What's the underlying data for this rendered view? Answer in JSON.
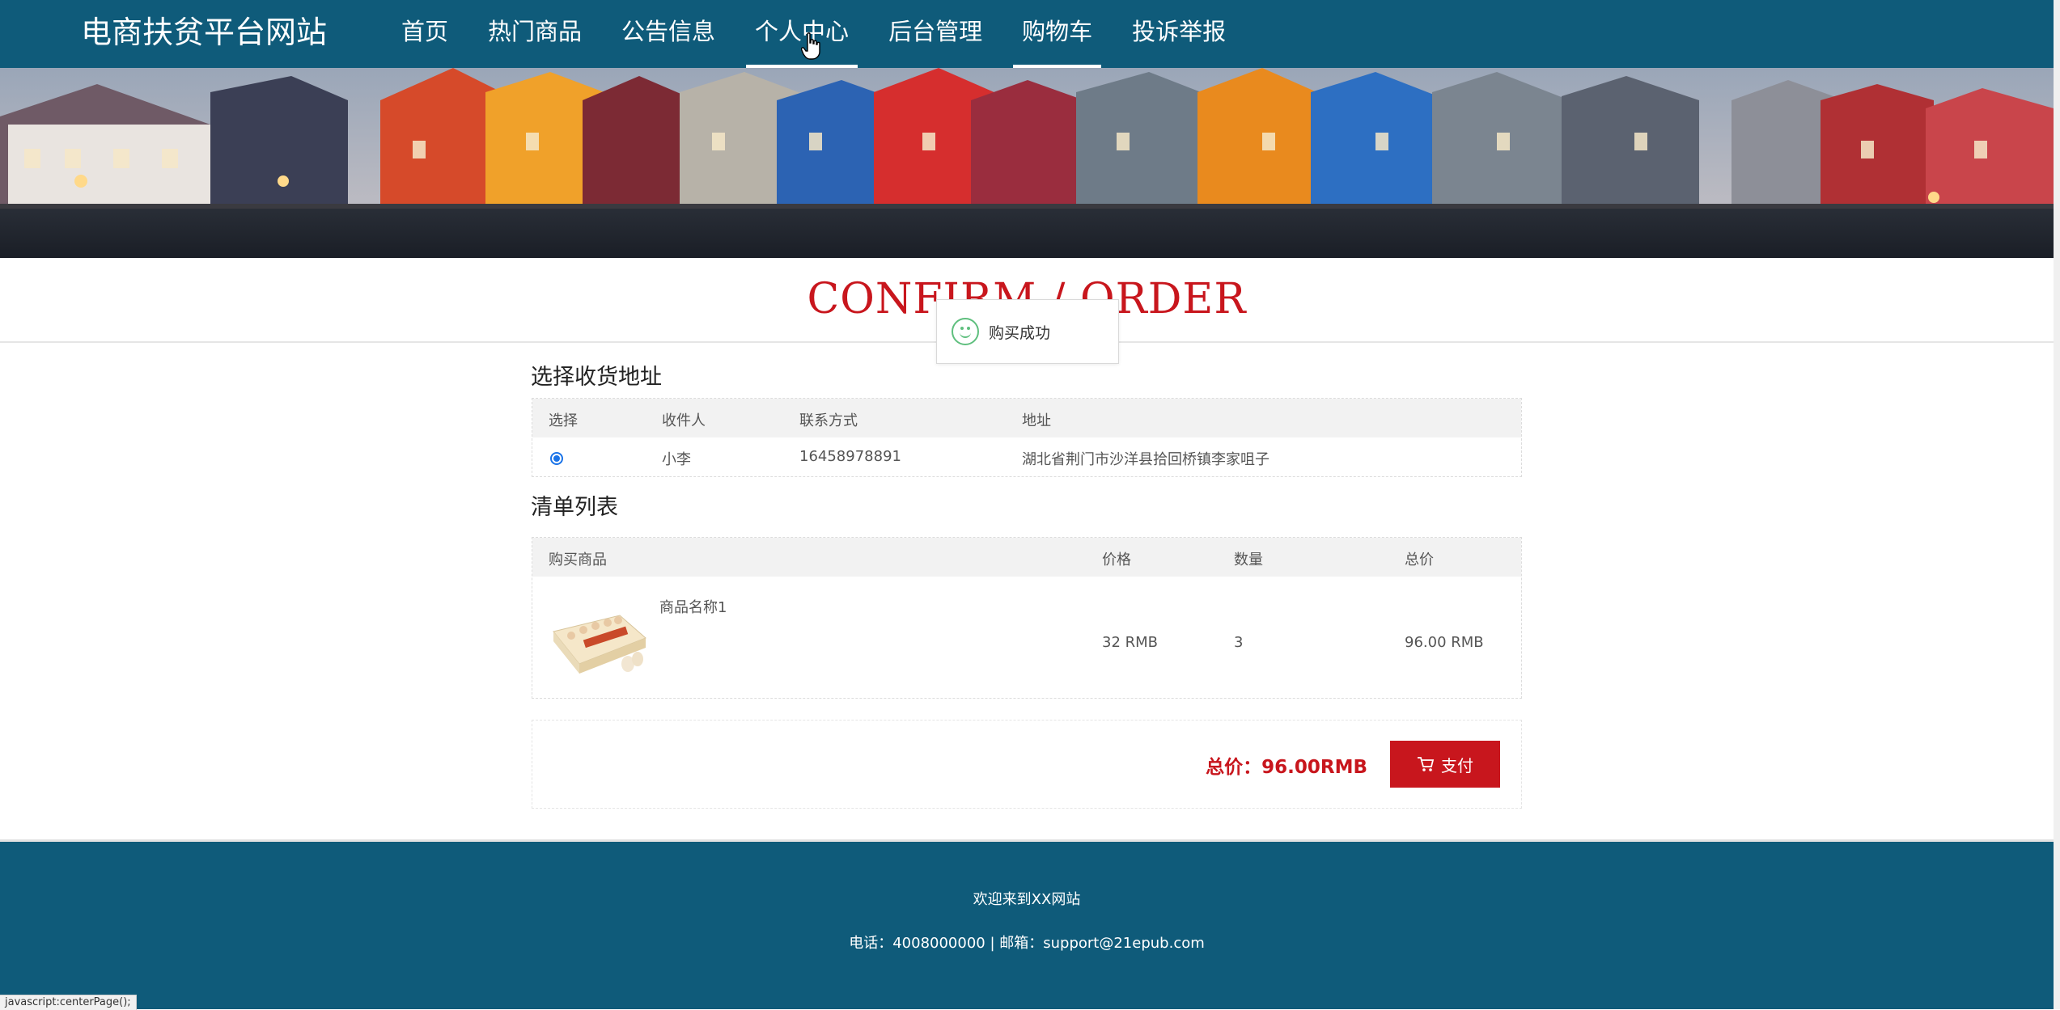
{
  "header": {
    "logo": "电商扶贫平台网站",
    "nav": [
      "首页",
      "热门商品",
      "公告信息",
      "个人中心",
      "后台管理",
      "购物车",
      "投诉举报"
    ]
  },
  "page_title": "CONFIRM / ORDER",
  "toast": {
    "message": "购买成功"
  },
  "address": {
    "title": "选择收货地址",
    "headers": [
      "选择",
      "收件人",
      "联系方式",
      "地址"
    ],
    "rows": [
      {
        "name": "小李",
        "phone": "16458978891",
        "address": "湖北省荆门市沙洋县拾回桥镇李家咀子",
        "selected": true
      }
    ]
  },
  "order": {
    "title": "清单列表",
    "headers": [
      "购买商品",
      "价格",
      "数量",
      "总价"
    ],
    "items": [
      {
        "name": "商品名称1",
        "price": "32 RMB",
        "qty": "3",
        "total": "96.00 RMB"
      }
    ]
  },
  "total": {
    "label": "总价：96.00RMB",
    "pay_button": "支付"
  },
  "footer": {
    "welcome": "欢迎来到XX网站",
    "contact": "电话：4008000000 | 邮箱：support@21epub.com"
  },
  "status_bar": "javascript:centerPage();",
  "colors": {
    "header_bg": "#0f5b7a",
    "accent_red": "#c8161d"
  }
}
